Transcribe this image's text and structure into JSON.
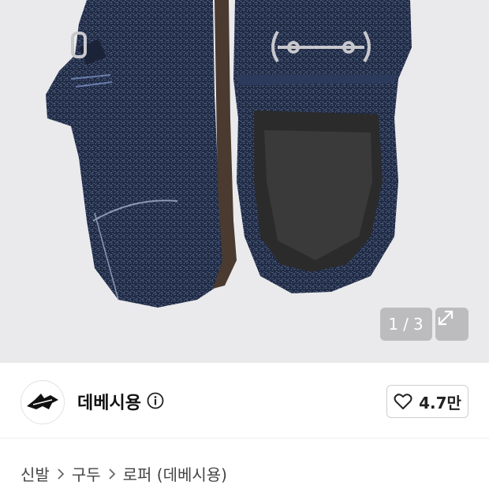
{
  "gallery": {
    "counter_current": "1",
    "counter_separator": "/",
    "counter_total": "3",
    "expand_icon": "expand-icon"
  },
  "shop": {
    "name": "데베시용",
    "info_icon": "info-icon",
    "avatar_icon": "bird-logo-icon",
    "like_icon": "heart-icon",
    "like_count": "4.7만"
  },
  "breadcrumb": {
    "items": [
      "신발",
      "구두",
      "로퍼 (데베시용)"
    ],
    "separator_icon": "chevron-right-icon"
  },
  "colors": {
    "hero_bg": "#eaeaec",
    "shoe_navy": "#1f2a44",
    "insole": "#2b2b2b",
    "overlay": "#96969b"
  }
}
